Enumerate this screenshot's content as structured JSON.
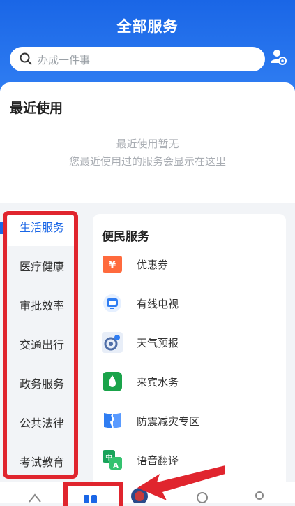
{
  "header": {
    "title": "全部服务"
  },
  "search": {
    "placeholder": "办成一件事"
  },
  "recent": {
    "title": "最近使用",
    "empty_line1": "最近使用暂无",
    "empty_line2": "您最近使用过的服务会显示在这里"
  },
  "sidebar": {
    "items": [
      {
        "label": "生活服务",
        "active": true
      },
      {
        "label": "医疗健康"
      },
      {
        "label": "审批效率"
      },
      {
        "label": "交通出行"
      },
      {
        "label": "政务服务"
      },
      {
        "label": "公共法律"
      },
      {
        "label": "考试教育"
      }
    ]
  },
  "panel": {
    "title": "便民服务",
    "items": [
      {
        "label": "优惠券",
        "icon": "coupon-icon",
        "color": "#ff6a3d"
      },
      {
        "label": "有线电视",
        "icon": "tv-icon",
        "color": "#2f7df2"
      },
      {
        "label": "天气预报",
        "icon": "weather-icon",
        "color": "#4f6ea8"
      },
      {
        "label": "来宾水务",
        "icon": "water-icon",
        "color": "#1aa34a"
      },
      {
        "label": "防震减灾专区",
        "icon": "earthquake-icon",
        "color": "#2f7df2"
      },
      {
        "label": "语音翻译",
        "icon": "translate-icon",
        "color": "#19a35a"
      }
    ]
  },
  "colors": {
    "accent": "#1a66e6",
    "highlight": "#e0252e"
  }
}
